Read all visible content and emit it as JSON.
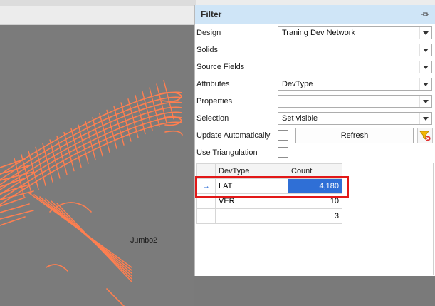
{
  "panel": {
    "title": "Filter",
    "pin_icon": "pin-icon"
  },
  "viewport": {
    "scene_label": "Jumbo2",
    "line_color": "#ff7f50"
  },
  "fields": {
    "design": {
      "label": "Design",
      "value": "Traning Dev Network"
    },
    "solids": {
      "label": "Solids",
      "value": ""
    },
    "source_fields": {
      "label": "Source Fields",
      "value": ""
    },
    "attributes": {
      "label": "Attributes",
      "value": "DevType"
    },
    "properties": {
      "label": "Properties",
      "value": ""
    },
    "selection": {
      "label": "Selection",
      "value": "Set visible"
    },
    "update_automatically": {
      "label": "Update Automatically",
      "checked": false
    },
    "use_triangulation": {
      "label": "Use Triangulation",
      "checked": false
    }
  },
  "refresh_label": "Refresh",
  "grid": {
    "headers": [
      "DevType",
      "Count"
    ],
    "rows": [
      {
        "indicator": "→",
        "devtype": "LAT",
        "count": "4,180"
      },
      {
        "indicator": "",
        "devtype": "VER",
        "count": "10"
      },
      {
        "indicator": "",
        "devtype": "",
        "count": "3"
      }
    ]
  },
  "colors": {
    "header_bg": "#cfe5f7",
    "selected_cell": "#2f6fd6",
    "highlight": "#e21818"
  }
}
